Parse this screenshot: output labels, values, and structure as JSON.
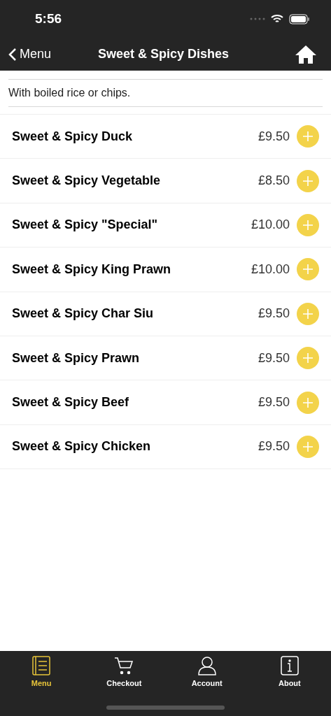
{
  "status_bar": {
    "time": "5:56"
  },
  "nav": {
    "back_label": "Menu",
    "title": "Sweet & Spicy Dishes"
  },
  "description": "With boiled rice or chips.",
  "items": [
    {
      "name": "Sweet & Spicy Duck",
      "price": "£9.50"
    },
    {
      "name": "Sweet & Spicy Vegetable",
      "price": "£8.50"
    },
    {
      "name": "Sweet & Spicy \"Special\"",
      "price": "£10.00"
    },
    {
      "name": "Sweet & Spicy King Prawn",
      "price": "£10.00"
    },
    {
      "name": "Sweet & Spicy Char Siu",
      "price": "£9.50"
    },
    {
      "name": "Sweet & Spicy Prawn",
      "price": "£9.50"
    },
    {
      "name": "Sweet & Spicy Beef",
      "price": "£9.50"
    },
    {
      "name": "Sweet & Spicy Chicken",
      "price": "£9.50"
    }
  ],
  "tab_bar": [
    {
      "label": "Menu",
      "selected": true
    },
    {
      "label": "Checkout",
      "selected": false
    },
    {
      "label": "Account",
      "selected": false
    },
    {
      "label": "About",
      "selected": false
    }
  ]
}
